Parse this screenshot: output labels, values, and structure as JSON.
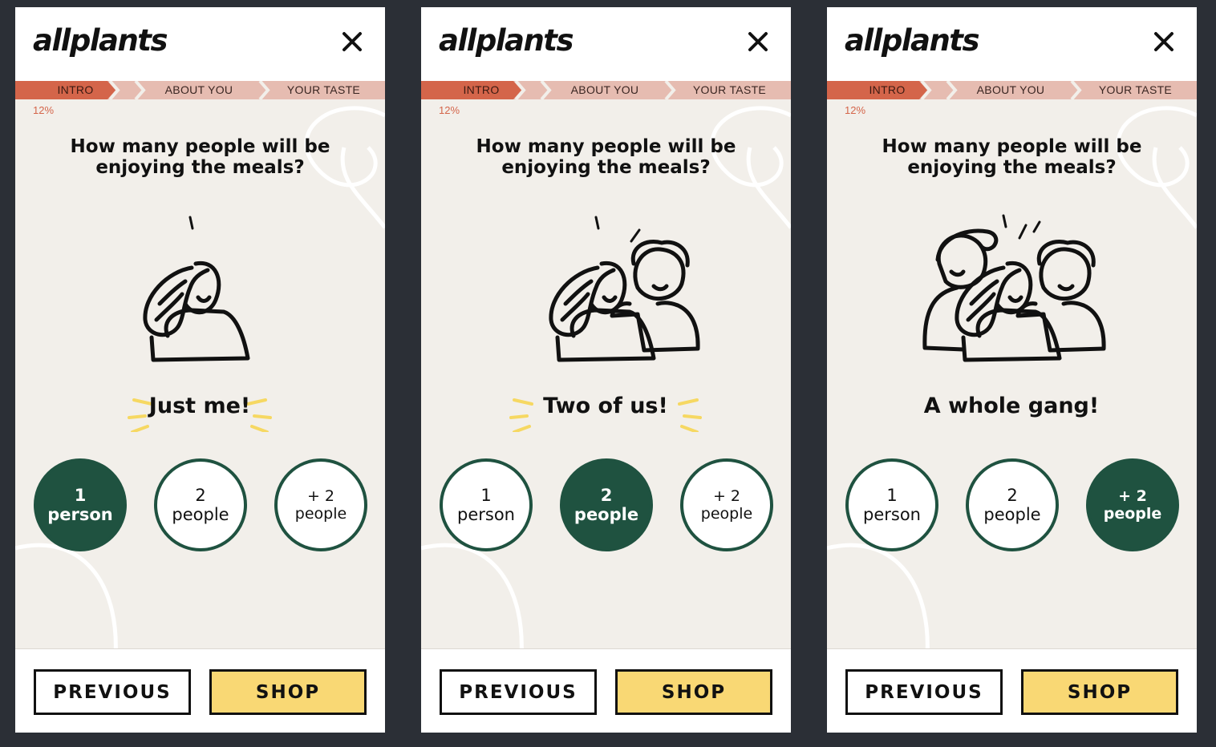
{
  "colors": {
    "accent_green": "#1f5240",
    "progress_active": "#d4654a",
    "progress_track": "#e6bcb1",
    "shop_yellow": "#f9d874",
    "background": "#f2efea"
  },
  "screens": [
    {
      "logo": "allplants",
      "close_icon": "close-icon",
      "steps": [
        "INTRO",
        "ABOUT YOU",
        "YOUR TASTE"
      ],
      "active_step": "INTRO",
      "progress": "12%",
      "question": "How many people will be enjoying the meals?",
      "illustration": "one-person-illustration",
      "caption": "Just me!",
      "options": [
        {
          "line1": "1",
          "line2": "person"
        },
        {
          "line1": "2",
          "line2": "people"
        },
        {
          "line1": "+ 2",
          "line2": "people"
        }
      ],
      "selected_option": 1,
      "previous_label": "PREVIOUS",
      "shop_label": "SHOP"
    },
    {
      "logo": "allplants",
      "close_icon": "close-icon",
      "steps": [
        "INTRO",
        "ABOUT YOU",
        "YOUR TASTE"
      ],
      "active_step": "INTRO",
      "progress": "12%",
      "question": "How many people will be enjoying the meals?",
      "illustration": "two-people-illustration",
      "caption": "Two of us!",
      "options": [
        {
          "line1": "1",
          "line2": "person"
        },
        {
          "line1": "2",
          "line2": "people"
        },
        {
          "line1": "+ 2",
          "line2": "people"
        }
      ],
      "selected_option": 2,
      "previous_label": "PREVIOUS",
      "shop_label": "SHOP"
    },
    {
      "logo": "allplants",
      "close_icon": "close-icon",
      "steps": [
        "INTRO",
        "ABOUT YOU",
        "YOUR TASTE"
      ],
      "active_step": "INTRO",
      "progress": "12%",
      "question": "How many people will be enjoying the meals?",
      "illustration": "group-illustration",
      "caption": "A whole gang!",
      "options": [
        {
          "line1": "1",
          "line2": "person"
        },
        {
          "line1": "2",
          "line2": "people"
        },
        {
          "line1": "+ 2",
          "line2": "people"
        }
      ],
      "selected_option": 3,
      "previous_label": "PREVIOUS",
      "shop_label": "SHOP"
    }
  ]
}
